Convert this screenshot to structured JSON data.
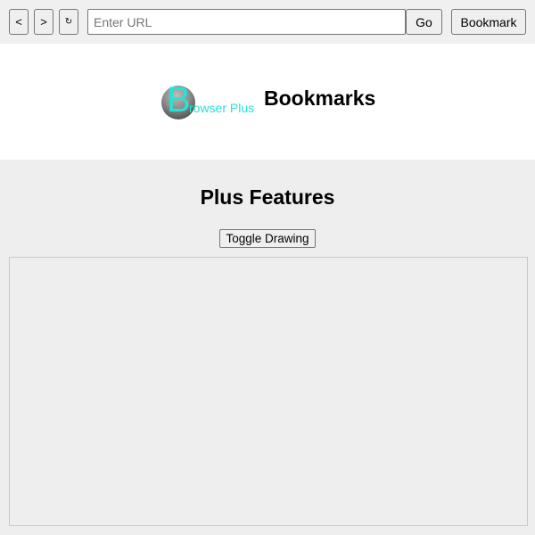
{
  "toolbar": {
    "back_label": "<",
    "forward_label": ">",
    "reload_label": "↻",
    "url_placeholder": "Enter URL",
    "url_value": "",
    "go_label": "Go",
    "bookmark_label": "Bookmark"
  },
  "header": {
    "logo_initial": "B",
    "logo_rest": "rowser Plus",
    "title": "Bookmarks"
  },
  "main": {
    "title": "Plus Features",
    "toggle_label": "Toggle Drawing"
  },
  "colors": {
    "logo_accent": "#27e3d6",
    "toolbar_bg": "#f0f0f0",
    "page_bg": "#eeeeee",
    "header_bg": "#ffffff"
  }
}
